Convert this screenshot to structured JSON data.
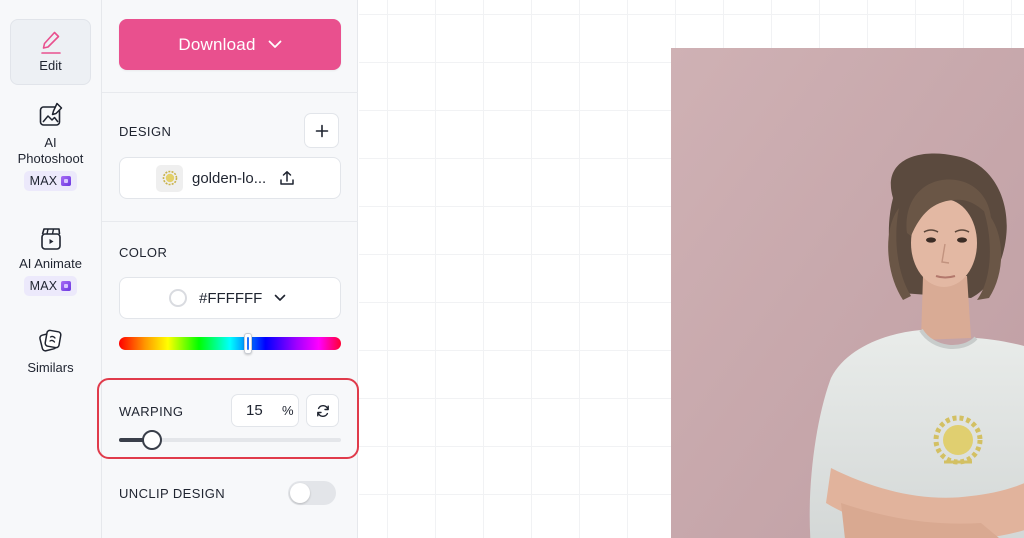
{
  "sidebar": {
    "items": [
      {
        "label": "Edit",
        "icon": "pencil-icon",
        "active": true
      },
      {
        "label": "AI Photoshoot",
        "icon": "image-sparkle-icon",
        "badge": "MAX"
      },
      {
        "label": "AI Animate",
        "icon": "clapperboard-icon",
        "badge": "MAX"
      },
      {
        "label": "Similars",
        "icon": "stacked-cards-icon"
      }
    ]
  },
  "panel": {
    "download_label": "Download",
    "design": {
      "section_label": "DESIGN",
      "file_name": "golden-lo..."
    },
    "color": {
      "section_label": "COLOR",
      "value": "#FFFFFF",
      "hue_position": 0.58
    },
    "warping": {
      "section_label": "WARPING",
      "value": "15",
      "unit": "%",
      "slider_fraction": 0.15
    },
    "unclip": {
      "label": "UNCLIP DESIGN",
      "enabled": false
    }
  },
  "colors": {
    "accent": "#E9508E",
    "highlight": "#E03B4B",
    "photo_background": "#C7A8AC",
    "shirt": "#E6E9E8",
    "print": "#D9C86A"
  }
}
